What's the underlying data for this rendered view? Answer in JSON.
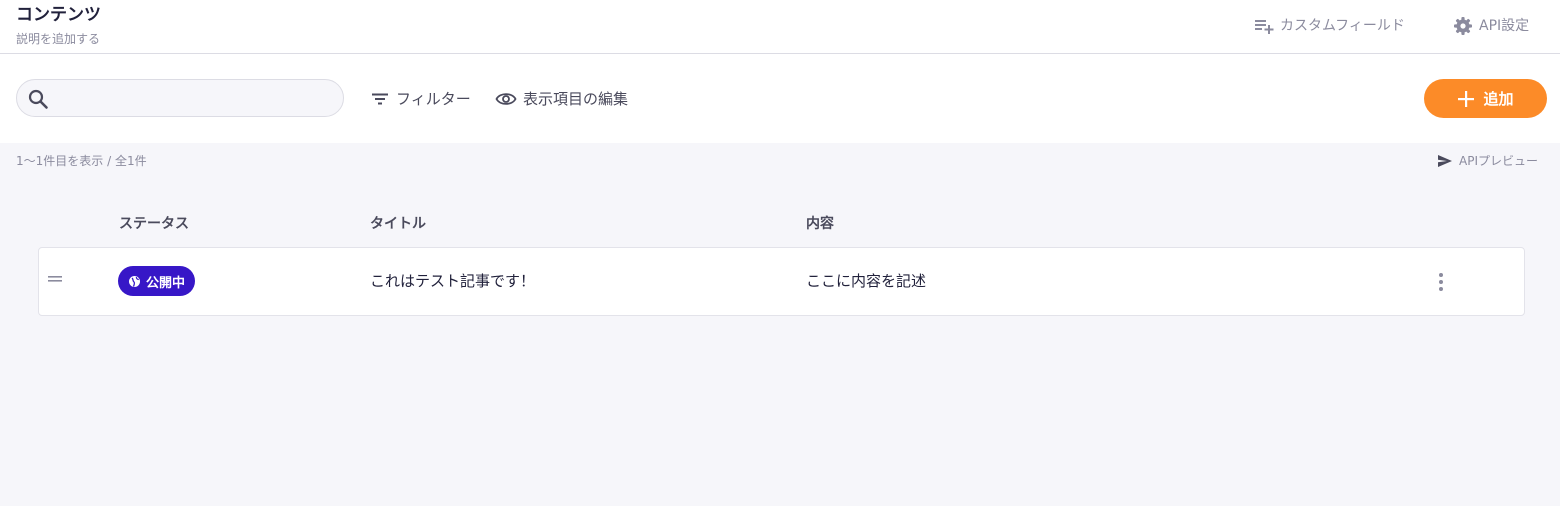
{
  "header": {
    "title": "コンテンツ",
    "description": "説明を追加する",
    "custom_fields_label": "カスタムフィールド",
    "api_settings_label": "API設定"
  },
  "toolbar": {
    "search_value": "",
    "search_placeholder": "",
    "filter_label": "フィルター",
    "edit_columns_label": "表示項目の編集",
    "add_label": "追加"
  },
  "list": {
    "count_text": "1〜1件目を表示 / 全1件",
    "api_preview_label": "APIプレビュー",
    "columns": [
      "ステータス",
      "タイトル",
      "内容"
    ],
    "rows": [
      {
        "status": "公開中",
        "title": "これはテスト記事です！",
        "content": "ここに内容を記述"
      }
    ]
  },
  "icons": {
    "custom_fields": "playlist-add-icon",
    "api_settings": "gear-icon",
    "search": "search-icon",
    "filter": "filter-icon",
    "edit_columns": "eye-icon",
    "add": "plus-icon",
    "api_preview": "send-icon",
    "drag": "drag-handle-icon",
    "status": "globe-icon",
    "more": "more-vertical-icon"
  },
  "colors": {
    "accent": "#fc8b28",
    "status_published": "#3717c7",
    "background": "#f6f6fa"
  }
}
